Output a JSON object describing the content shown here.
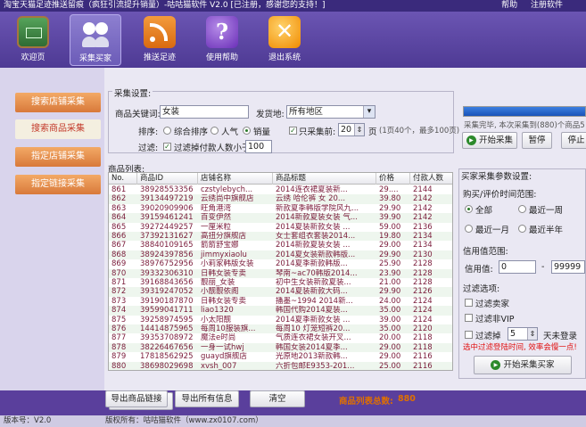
{
  "window": {
    "title": "淘宝天猫足迹推送留痕（疯狂引流提升销量）-咕咕猫软件 V2.0 [已注册，感谢您的支持！]",
    "help": "帮助",
    "register": "注册软件"
  },
  "toolbar": [
    {
      "label": "欢迎页",
      "icon": "blackboard-icon"
    },
    {
      "label": "采集买家",
      "icon": "users-icon"
    },
    {
      "label": "推送足迹",
      "icon": "rss-icon"
    },
    {
      "label": "使用帮助",
      "icon": "help-icon",
      "glyph": "?"
    },
    {
      "label": "退出系统",
      "icon": "exit-icon",
      "glyph": "✕"
    }
  ],
  "sidebar": [
    {
      "label": "搜索店铺采集"
    },
    {
      "label": "搜索商品采集"
    },
    {
      "label": "指定店铺采集"
    },
    {
      "label": "指定链接采集"
    }
  ],
  "caiji": {
    "group_title": "采集设置:",
    "keyword_label": "商品关键词:",
    "keyword_value": "女装",
    "ship_label": "发货地:",
    "ship_value": "所有地区",
    "sort_label": "排序:",
    "sort_options": [
      "综合排序",
      "人气",
      "销量"
    ],
    "sort_selected": 2,
    "only_first_label": "只采集前:",
    "only_first_checked": true,
    "only_first_value": "20",
    "pages_unit": "页",
    "pages_hint": "(1页40个，最多100页)",
    "filter_label": "过滤:",
    "filter_text": "过滤掉付款人数小于",
    "filter_checked": true,
    "filter_value": "100"
  },
  "progress": {
    "percent": 100,
    "status": "采集完毕, 本次采集到(880)个商品5",
    "start": "开始采集",
    "pause": "暂停",
    "stop": "停止"
  },
  "product_list": {
    "title": "商品列表:",
    "columns": [
      "No.",
      "商品ID",
      "店铺名称",
      "商品标题",
      "价格",
      "付款人数"
    ],
    "rows": [
      [
        "861",
        "38928553356",
        "czstylebych...",
        "2014连衣裙夏装新...",
        "29....",
        "2144"
      ],
      [
        "862",
        "39134497219",
        "云绣尚中旗舰店",
        "云绣 哈伦裤 女 20...",
        "39.80",
        "2142"
      ],
      [
        "863",
        "39020909906",
        "旺角港湾",
        "新款夏季韩版学院风九...",
        "29.90",
        "2142"
      ],
      [
        "864",
        "39159461241",
        "百变伊然",
        "2014新款夏装女装 气...",
        "39.90",
        "2142"
      ],
      [
        "865",
        "39272449257",
        "一厘米粒",
        "2014夏装新款女装 ...",
        "59.00",
        "2136"
      ],
      [
        "866",
        "37392131627",
        "高扭分旗舰店",
        "女士套组衣套装2014...",
        "19.80",
        "2134"
      ],
      [
        "867",
        "38840109165",
        "箭箭舒宝娜",
        "2014新款夏装女装 ...",
        "29.00",
        "2134"
      ],
      [
        "868",
        "38924397856",
        "jimmyxiaolu",
        "2014夏女装新款韩版...",
        "29.90",
        "2130"
      ],
      [
        "869",
        "38976752956",
        "小莉家韩版女装",
        "2014夏季新款韩版...",
        "25.90",
        "2128"
      ],
      [
        "870",
        "39332306310",
        "日韩女装专卖",
        "琴南~ac70韩版2014...",
        "23.90",
        "2128"
      ],
      [
        "871",
        "39168843656",
        "靓丽_女装",
        "初中生女装新款夏装...",
        "21.00",
        "2128"
      ],
      [
        "872",
        "39319247052",
        "小靓靓依阁",
        "2014夏装新款大码...",
        "29.90",
        "2126"
      ],
      [
        "873",
        "39190187870",
        "日韩女装专卖",
        "播墨~1994 2014新...",
        "24.00",
        "2124"
      ],
      [
        "874",
        "39599041711",
        "liao1320",
        "韩国代购2014夏装...",
        "35.00",
        "2124"
      ],
      [
        "875",
        "39258974595",
        "小太阳靓",
        "2014夏季新款女装 ...",
        "39.00",
        "2124"
      ],
      [
        "876",
        "14414875965",
        "每周10服装旗...",
        "每周10 灯笼短裤20...",
        "35.00",
        "2120"
      ],
      [
        "877",
        "39353708972",
        "魔法e时尚",
        "气质连衣裙女装开叉...",
        "20.00",
        "2118"
      ],
      [
        "878",
        "38226467656",
        "一身一试hwj",
        "韩国女装2014夏季...",
        "29.00",
        "2118"
      ],
      [
        "879",
        "17818562925",
        "guayd旗舰店",
        "光原地2013新款韩...",
        "29.00",
        "2116"
      ],
      [
        "880",
        "38698029698",
        "xvsh_007",
        "六折包邮E9353-201...",
        "25.00",
        "2116"
      ]
    ],
    "export_links": "导出商品链接",
    "export_all": "导出所有信息",
    "clear": "清空",
    "total_label": "商品列表总数:",
    "total_value": "880"
  },
  "settings": {
    "title": "买家采集参数设置:",
    "range_label": "购买/评价时间范围:",
    "range_options": [
      "全部",
      "最近一周",
      "最近一月",
      "最近半年"
    ],
    "range_selected": 0,
    "credit_label": "信用值范围:",
    "credit_field_label": "信用值:",
    "credit_min": "0",
    "credit_dash": "-",
    "credit_max": "99999",
    "filter_title": "过滤选项:",
    "filter_seller": "过滤卖家",
    "filter_vip": "过滤非VIP",
    "filter_login": "过滤掉",
    "login_days": "5",
    "login_suffix": "天未登录",
    "warning": "选中过滤登陆时间, 效率会慢一点!",
    "start_buyers": "开始采集买家"
  },
  "statusbar": {
    "version": "版本号：V2.0",
    "copyright": "版权所有：咕咕猫软件（www.zx0107.com）"
  },
  "colors": {
    "frame": "#5a3f9c",
    "sidebar_button": "#d8793a",
    "row_text": "#7a1b3a",
    "total": "#e07000"
  }
}
